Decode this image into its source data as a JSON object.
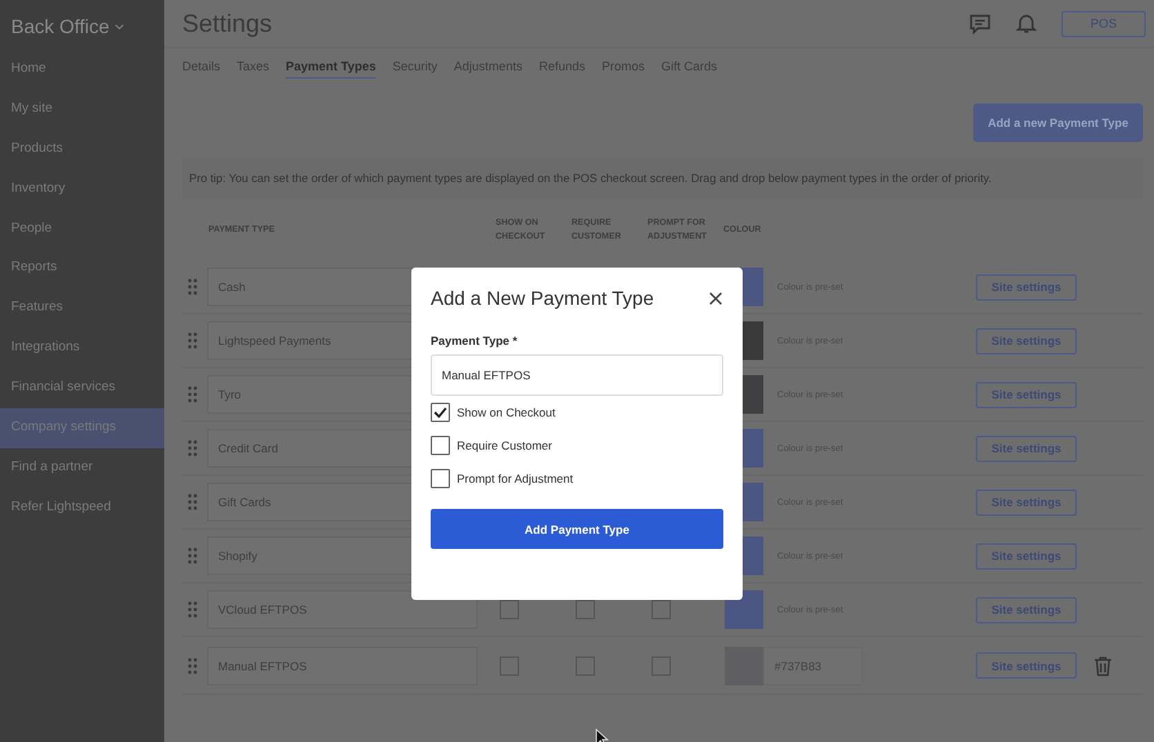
{
  "sidebar": {
    "title": "Back Office",
    "items": [
      {
        "label": "Home",
        "selected": false
      },
      {
        "label": "My site",
        "selected": false
      },
      {
        "label": "Products",
        "selected": false
      },
      {
        "label": "Inventory",
        "selected": false
      },
      {
        "label": "People",
        "selected": false
      },
      {
        "label": "Reports",
        "selected": false
      },
      {
        "label": "Features",
        "selected": false
      },
      {
        "label": "Integrations",
        "selected": false
      },
      {
        "label": "Financial services",
        "selected": false
      },
      {
        "label": "Company settings",
        "selected": true
      },
      {
        "label": "Find a partner",
        "selected": false
      },
      {
        "label": "Refer Lightspeed",
        "selected": false
      }
    ]
  },
  "header": {
    "title": "Settings",
    "pos_button": "POS"
  },
  "tabs": [
    {
      "label": "Details",
      "selected": false
    },
    {
      "label": "Taxes",
      "selected": false
    },
    {
      "label": "Payment Types",
      "selected": true
    },
    {
      "label": "Security",
      "selected": false
    },
    {
      "label": "Adjustments",
      "selected": false
    },
    {
      "label": "Refunds",
      "selected": false
    },
    {
      "label": "Promos",
      "selected": false
    },
    {
      "label": "Gift Cards",
      "selected": false
    }
  ],
  "add_button": "Add a new Payment Type",
  "pro_tip": "Pro tip: You can set the order of which payment types are displayed on the POS checkout screen. Drag and drop below payment types in the order of priority.",
  "table": {
    "columns": [
      "PAYMENT TYPE",
      "SHOW ON CHECKOUT",
      "REQUIRE CUSTOMER",
      "PROMPT FOR ADJUSTMENT",
      "COLOUR"
    ],
    "rows": [
      {
        "name": "Cash",
        "color": "#4b5683",
        "kind": "preset",
        "colour_text": "Colour is pre-set",
        "button": "Site settings",
        "deletable": false
      },
      {
        "name": "Lightspeed Payments",
        "color": "#393939",
        "kind": "preset",
        "colour_text": "Colour is pre-set",
        "button": "Site settings",
        "deletable": false
      },
      {
        "name": "Tyro",
        "color": "#3f3f42",
        "kind": "preset",
        "colour_text": "Colour is pre-set",
        "button": "Site settings",
        "deletable": false
      },
      {
        "name": "Credit Card",
        "color": "#4b5683",
        "kind": "preset",
        "colour_text": "Colour is pre-set",
        "button": "Site settings",
        "deletable": false
      },
      {
        "name": "Gift Cards",
        "color": "#4b5683",
        "kind": "preset",
        "colour_text": "Colour is pre-set",
        "button": "Site settings",
        "deletable": false
      },
      {
        "name": "Shopify",
        "color": "#4b5683",
        "kind": "preset",
        "colour_text": "Colour is pre-set",
        "button": "Site settings",
        "deletable": false
      },
      {
        "name": "VCloud EFTPOS",
        "color": "#4b5683",
        "kind": "preset",
        "colour_text": "Colour is pre-set",
        "show_on_checkout": false,
        "require_customer": false,
        "prompt_for_adjustment": false,
        "button": "Site settings",
        "deletable": false
      },
      {
        "name": "Manual EFTPOS",
        "color": "#5f5f61",
        "kind": "custom",
        "colour_text": "#737B83",
        "show_on_checkout": false,
        "require_customer": false,
        "prompt_for_adjustment": false,
        "button": "Site settings",
        "deletable": true
      }
    ]
  },
  "modal": {
    "title": "Add a New Payment Type",
    "field_label": "Payment Type *",
    "field_value": "Manual EFTPOS",
    "options": [
      {
        "label": "Show on Checkout",
        "checked": true
      },
      {
        "label": "Require Customer",
        "checked": false
      },
      {
        "label": "Prompt for Adjustment",
        "checked": false
      }
    ],
    "submit": "Add Payment Type"
  }
}
